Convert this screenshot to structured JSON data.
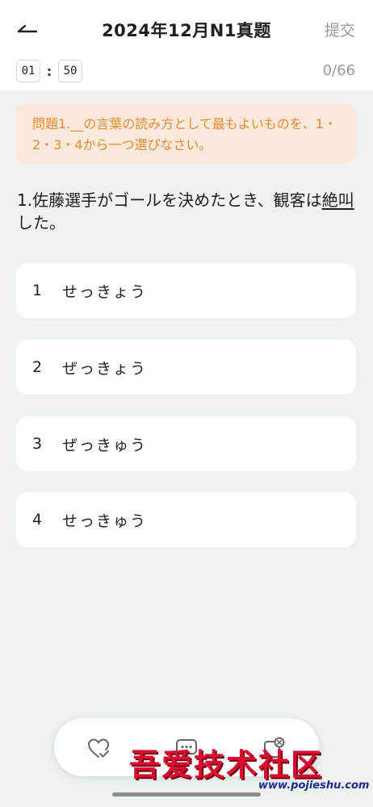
{
  "header": {
    "title": "2024年12月N1真题",
    "submit_label": "提交",
    "back_icon": "back-arrow-icon"
  },
  "timer": {
    "minutes": "01",
    "separator": ":",
    "seconds": "50"
  },
  "progress": "0/66",
  "instruction": "問題1.__の言葉の読み方として最もよいものを、1・2・3・4から一つ選びなさい。",
  "question": {
    "prefix": "1.佐藤選手がゴールを決めたとき、観客は",
    "underlined": "絶叫",
    "suffix": "した。"
  },
  "options": [
    {
      "number": "1",
      "text": "せっきょう"
    },
    {
      "number": "2",
      "text": "ぜっきょう"
    },
    {
      "number": "3",
      "text": "ぜっきゅう"
    },
    {
      "number": "4",
      "text": "せっきゅう"
    }
  ],
  "toolbar": {
    "icons": [
      "heart-check-icon",
      "comment-icon",
      "error-note-icon"
    ]
  },
  "watermark": {
    "text": "吾爱技术社区",
    "url": "www.pojieshu.com"
  },
  "colors": {
    "accent": "#f08a2c",
    "instruction_bg": "#fbe9dd",
    "page_bg": "#eef3f2",
    "watermark": "#d90d2d"
  }
}
